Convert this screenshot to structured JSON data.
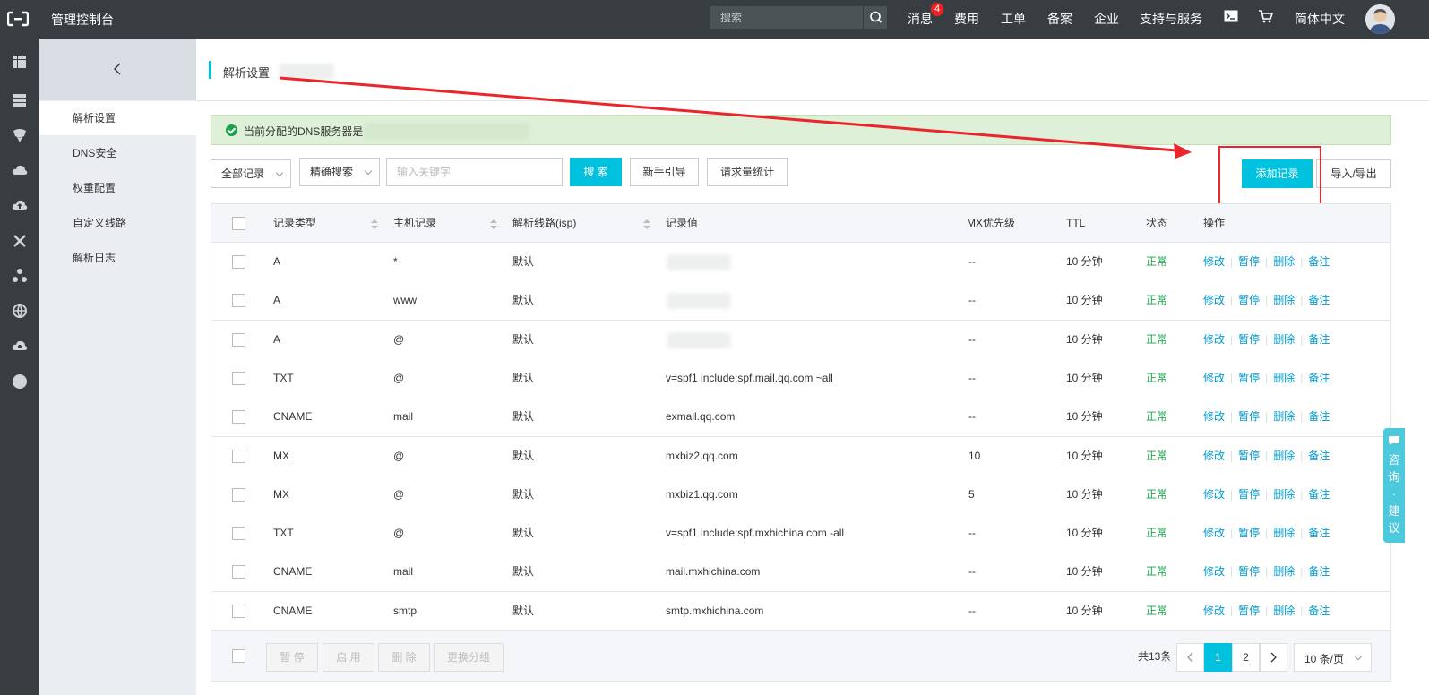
{
  "topbar": {
    "title": "管理控制台",
    "search_placeholder": "搜索",
    "nav": [
      "消息",
      "费用",
      "工单",
      "备案",
      "企业",
      "支持与服务",
      "简体中文"
    ],
    "message_badge": "4"
  },
  "sidebar": {
    "items": [
      "解析设置",
      "DNS安全",
      "权重配置",
      "自定义线路",
      "解析日志"
    ],
    "active_index": 0
  },
  "page": {
    "title": "解析设置",
    "alert": "当前分配的DNS服务器是"
  },
  "toolbar": {
    "record_filter": "全部记录",
    "search_mode": "精确搜索",
    "keyword_placeholder": "输入关键字",
    "search_label": "搜 索",
    "guide_label": "新手引导",
    "stats_label": "请求量统计",
    "add_label": "添加记录",
    "import_export_label": "导入/导出"
  },
  "table": {
    "headers": {
      "type": "记录类型",
      "host": "主机记录",
      "line": "解析线路(isp)",
      "value": "记录值",
      "mx": "MX优先级",
      "ttl": "TTL",
      "status": "状态",
      "ops": "操作"
    },
    "op_labels": [
      "修改",
      "暂停",
      "删除",
      "备注"
    ],
    "rows": [
      {
        "type": "A",
        "host": "*",
        "line": "默认",
        "value": "",
        "mx": "--",
        "ttl": "10 分钟",
        "status": "正常"
      },
      {
        "type": "A",
        "host": "www",
        "line": "默认",
        "value": "",
        "mx": "--",
        "ttl": "10 分钟",
        "status": "正常"
      },
      {
        "type": "A",
        "host": "@",
        "line": "默认",
        "value": "",
        "mx": "--",
        "ttl": "10 分钟",
        "status": "正常"
      },
      {
        "type": "TXT",
        "host": "@",
        "line": "默认",
        "value": "v=spf1 include:spf.mail.qq.com ~all",
        "mx": "--",
        "ttl": "10 分钟",
        "status": "正常"
      },
      {
        "type": "CNAME",
        "host": "mail",
        "line": "默认",
        "value": "exmail.qq.com",
        "mx": "--",
        "ttl": "10 分钟",
        "status": "正常"
      },
      {
        "type": "MX",
        "host": "@",
        "line": "默认",
        "value": "mxbiz2.qq.com",
        "mx": "10",
        "ttl": "10 分钟",
        "status": "正常"
      },
      {
        "type": "MX",
        "host": "@",
        "line": "默认",
        "value": "mxbiz1.qq.com",
        "mx": "5",
        "ttl": "10 分钟",
        "status": "正常"
      },
      {
        "type": "TXT",
        "host": "@",
        "line": "默认",
        "value": "v=spf1 include:spf.mxhichina.com -all",
        "mx": "--",
        "ttl": "10 分钟",
        "status": "正常"
      },
      {
        "type": "CNAME",
        "host": "mail",
        "line": "默认",
        "value": "mail.mxhichina.com",
        "mx": "--",
        "ttl": "10 分钟",
        "status": "正常"
      },
      {
        "type": "CNAME",
        "host": "smtp",
        "line": "默认",
        "value": "smtp.mxhichina.com",
        "mx": "--",
        "ttl": "10 分钟",
        "status": "正常"
      }
    ]
  },
  "footer": {
    "batch_buttons": [
      "暂 停",
      "启 用",
      "删 除",
      "更换分组"
    ],
    "total": "共13条",
    "pages": [
      "1",
      "2"
    ],
    "current_page": "1",
    "page_size": "10 条/页"
  },
  "consult": [
    "咨",
    "询",
    "·",
    "建",
    "议"
  ],
  "colors": {
    "topbar": "#373d41",
    "accent": "#00c1de",
    "status_ok": "#1aa34a",
    "link": "#0099cc",
    "annotation": "#e8262c"
  }
}
